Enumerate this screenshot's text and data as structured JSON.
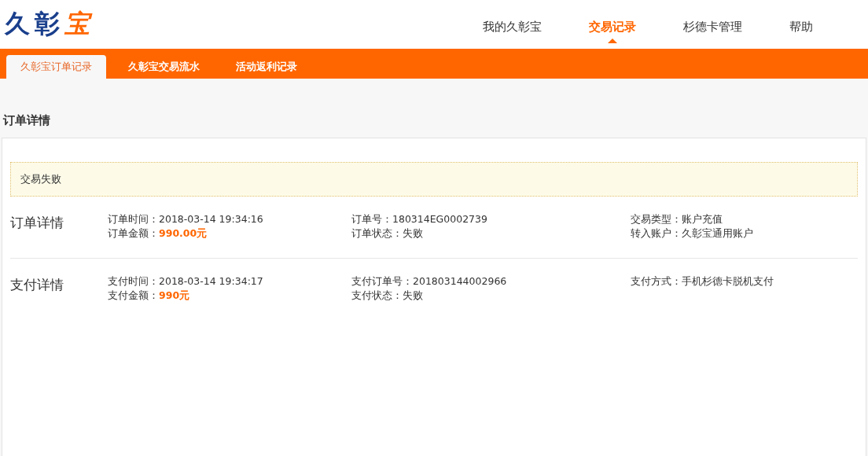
{
  "logo": {
    "text": "久彰",
    "accent": "宝"
  },
  "nav": [
    {
      "label": "我的久彰宝",
      "selected": false
    },
    {
      "label": "交易记录",
      "selected": true
    },
    {
      "label": "杉德卡管理",
      "selected": false
    },
    {
      "label": "帮助",
      "selected": false
    }
  ],
  "tabs": [
    {
      "label": "久彰宝订单记录",
      "selected": true
    },
    {
      "label": "久彰宝交易流水",
      "selected": false
    },
    {
      "label": "活动返利记录",
      "selected": false
    }
  ],
  "page_title": "订单详情",
  "notice": "交易失败",
  "sections": [
    {
      "title": "订单详情",
      "columns": [
        [
          {
            "label": "订单时间：",
            "value": "2018-03-14 19:34:16",
            "highlight": false
          },
          {
            "label": "订单金额：",
            "value": "990.00元",
            "highlight": true
          }
        ],
        [
          {
            "label": "订单号：",
            "value": "180314EG0002739",
            "highlight": false
          },
          {
            "label": "订单状态：",
            "value": "失败",
            "highlight": false
          }
        ],
        [
          {
            "label": "交易类型：",
            "value": "账户充值",
            "highlight": false
          },
          {
            "label": "转入账户：",
            "value": "久彰宝通用账户",
            "highlight": false
          }
        ]
      ]
    },
    {
      "title": "支付详情",
      "columns": [
        [
          {
            "label": "支付时间：",
            "value": "2018-03-14 19:34:17",
            "highlight": false
          },
          {
            "label": "支付金额：",
            "value": "990元",
            "highlight": true
          }
        ],
        [
          {
            "label": "支付订单号：",
            "value": "201803144002966",
            "highlight": false
          },
          {
            "label": "支付状态：",
            "value": "失败",
            "highlight": false
          }
        ],
        [
          {
            "label": "支付方式：",
            "value": "手机杉德卡脱机支付",
            "highlight": false
          }
        ]
      ]
    }
  ]
}
